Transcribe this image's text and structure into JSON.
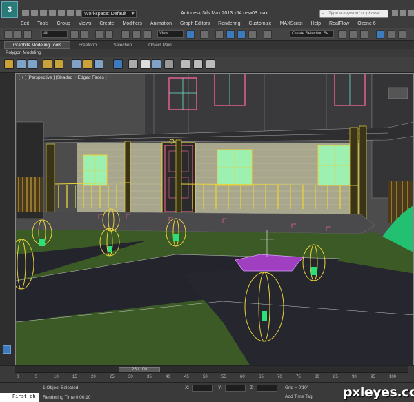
{
  "titlebar": {
    "logo_text": "3",
    "workspace": "Workspace: Default",
    "title": "Autodesk 3ds Max 2013 x64       new03.max",
    "search_placeholder": "Type a keyword or phrase"
  },
  "menu": {
    "items": [
      "Edit",
      "Tools",
      "Group",
      "Views",
      "Create",
      "Modifiers",
      "Animation",
      "Graph Editors",
      "Rendering",
      "Customize",
      "MAXScript",
      "Help",
      "RealFlow",
      "Ozone 6"
    ]
  },
  "toolbar": {
    "filter_value": "All",
    "view_value": "View",
    "selection_set_value": "Create Selection Se"
  },
  "ribbon": {
    "tabs": [
      "Graphite Modeling Tools",
      "Freeform",
      "Selection",
      "Object Paint"
    ],
    "panel_label": "Polygon Modeling"
  },
  "viewport": {
    "label": "[ + ] [Perspective ] [Shaded + Edged Faces ]"
  },
  "timeline": {
    "frame_indicator": "25 / 100",
    "ticks": [
      "0",
      "5",
      "10",
      "15",
      "20",
      "25",
      "30",
      "35",
      "40",
      "45",
      "50",
      "55",
      "60",
      "65",
      "70",
      "75",
      "80",
      "85",
      "90",
      "95",
      "100"
    ]
  },
  "status": {
    "maxscript_text": "First ch",
    "selection": "1 Object Selected",
    "render_time": "Rendering Time  0:00:10",
    "x_label": "X:",
    "y_label": "Y:",
    "z_label": "Z:",
    "grid": "Grid = 0'10\"",
    "add_time_tag": "Add Time Tag"
  },
  "watermark": "pxleyes.com",
  "colors": {
    "accent_blue": "#3d7bbf",
    "wire_yellow": "#e8d23a",
    "window_green": "#9ef0b0",
    "grass": "#3b5a25",
    "road": "#24242c",
    "table_purple": "#a040c0"
  }
}
